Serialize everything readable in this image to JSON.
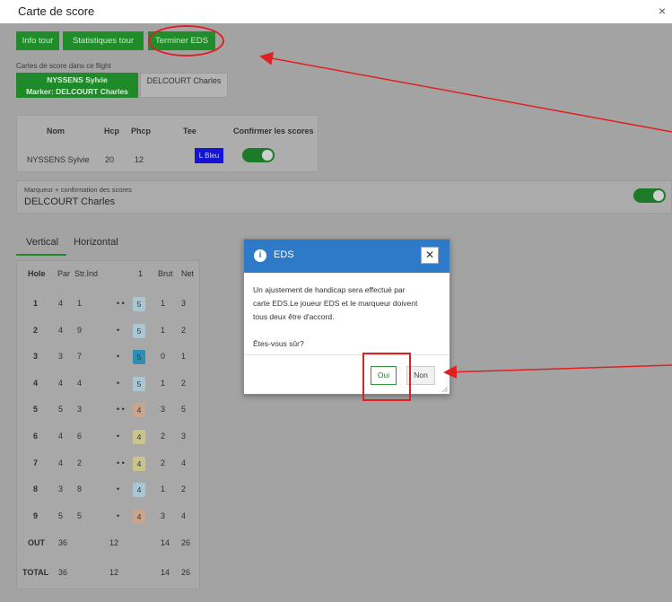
{
  "window": {
    "title": "Carte de score",
    "close_glyph": "×"
  },
  "toolbar": {
    "info_tour": "Info tour",
    "statistiques_tour": "Statistiques tour",
    "terminer_eds": "Terminer EDS"
  },
  "cards_label": "Cartes de score dans ce flight",
  "cards": {
    "selected_line1": "NYSSENS Sylvie",
    "selected_line2": "Marker: DELCOURT Charles",
    "other": "DELCOURT Charles"
  },
  "player_table": {
    "headers": {
      "nom": "Nom",
      "hcp": "Hcp",
      "phcp": "Phcp",
      "tee": "Tee",
      "confirm": "Confirmer les scores"
    },
    "row": {
      "nom": "NYSSENS Sylvie",
      "hcp": "20",
      "phcp": "12",
      "tee": "L Bleu"
    }
  },
  "marqueur": {
    "label": "Marqueur + confirmation des scores",
    "name": "DELCOURT Charles"
  },
  "tabs": {
    "vertical": "Vertical",
    "horizontal": "Horizontal"
  },
  "scorecard": {
    "headers": {
      "hole": "Hole",
      "par": "Par",
      "strind": "Str.Ind",
      "round": "1",
      "brut": "Brut",
      "net": "Net"
    },
    "rows": [
      {
        "hole": "1",
        "par": "4",
        "si": "1",
        "dots": "• •",
        "score": "5",
        "brut": "1",
        "net": "3",
        "color": "#a9c7d3"
      },
      {
        "hole": "2",
        "par": "4",
        "si": "9",
        "dots": "•",
        "score": "5",
        "brut": "1",
        "net": "2",
        "color": "#a9c7d3"
      },
      {
        "hole": "3",
        "par": "3",
        "si": "7",
        "dots": "•",
        "score": "5",
        "brut": "0",
        "net": "1",
        "color": "#2b8fb1"
      },
      {
        "hole": "4",
        "par": "4",
        "si": "4",
        "dots": "•",
        "score": "5",
        "brut": "1",
        "net": "2",
        "color": "#a9c7d3"
      },
      {
        "hole": "5",
        "par": "5",
        "si": "3",
        "dots": "• •",
        "score": "4",
        "brut": "3",
        "net": "5",
        "color": "#c9a58e"
      },
      {
        "hole": "6",
        "par": "4",
        "si": "6",
        "dots": "•",
        "score": "4",
        "brut": "2",
        "net": "3",
        "color": "#c9c58a"
      },
      {
        "hole": "7",
        "par": "4",
        "si": "2",
        "dots": "• •",
        "score": "4",
        "brut": "2",
        "net": "4",
        "color": "#c9c58a"
      },
      {
        "hole": "8",
        "par": "3",
        "si": "8",
        "dots": "•",
        "score": "4",
        "brut": "1",
        "net": "2",
        "color": "#a9c7d3"
      },
      {
        "hole": "9",
        "par": "5",
        "si": "5",
        "dots": "•",
        "score": "4",
        "brut": "3",
        "net": "4",
        "color": "#c9a58e"
      }
    ],
    "out": {
      "label": "OUT",
      "par": "36",
      "hcp": "12",
      "brut": "14",
      "net": "26"
    },
    "total": {
      "label": "TOTAL",
      "par": "36",
      "hcp": "12",
      "brut": "14",
      "net": "26"
    }
  },
  "dialog": {
    "title": "EDS",
    "close_glyph": "✕",
    "line1": "Un ajustement de handicap sera effectué par",
    "line2": "carte EDS.Le joueur EDS et le marqueur doivent",
    "line3": "tous deux être d'accord.",
    "question": "Êtes-vous sûr?",
    "oui": "Oui",
    "non": "Non"
  },
  "colors": {
    "green": "#1f8a2a",
    "blue_header": "#2f79c9",
    "annotation_red": "#e02020"
  }
}
